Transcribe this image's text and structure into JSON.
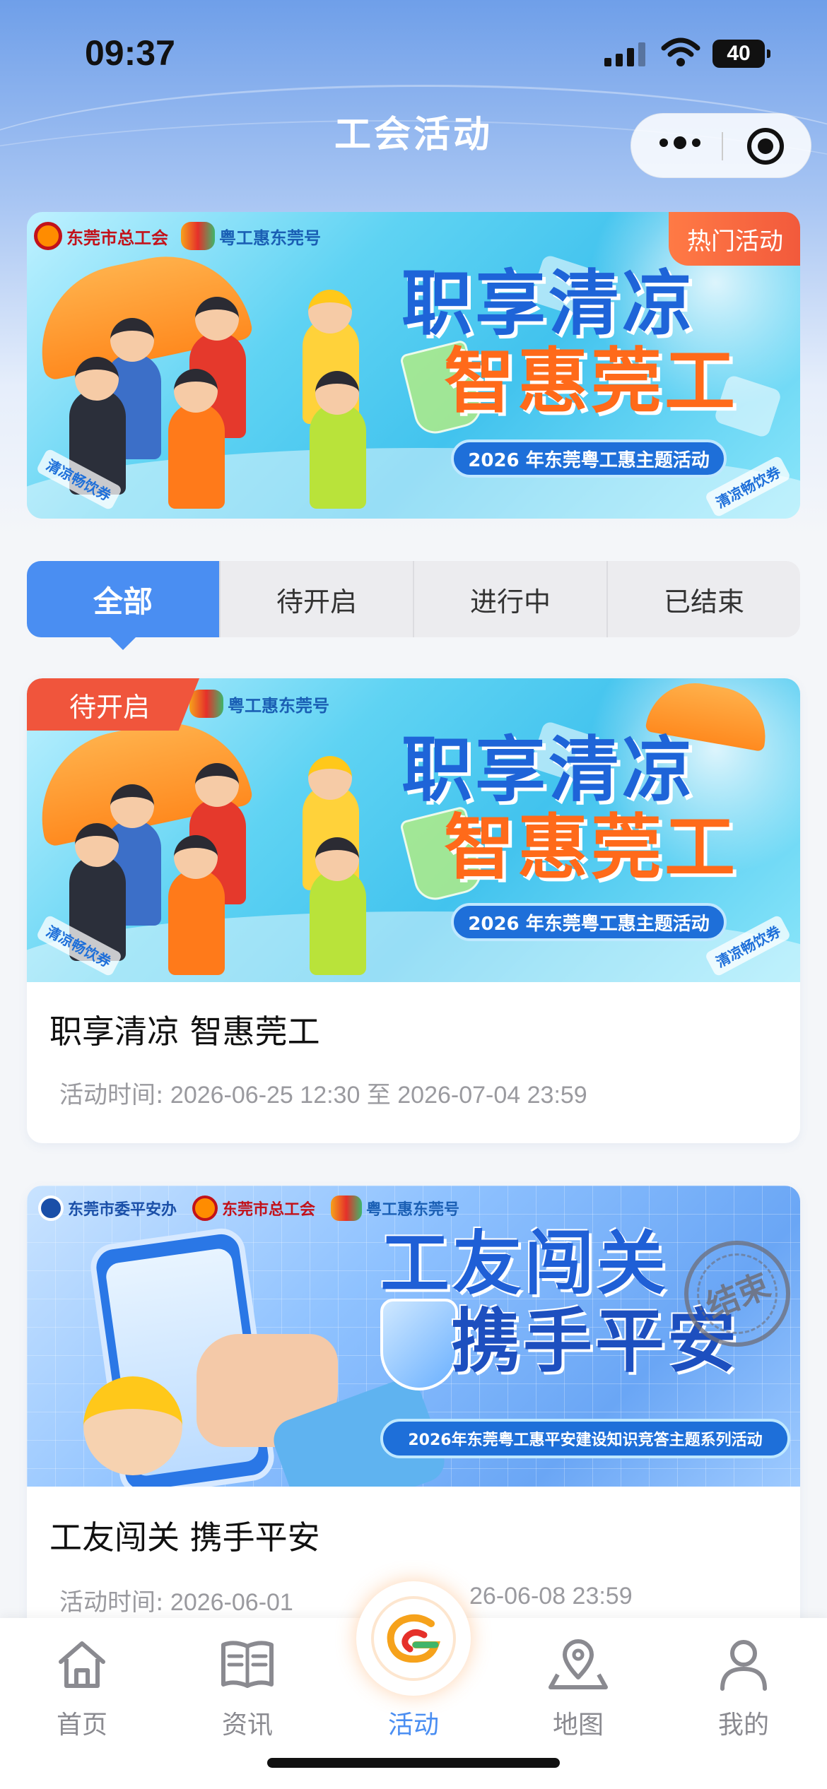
{
  "status_bar": {
    "time": "09:37",
    "battery": "40"
  },
  "nav": {
    "title": "工会活动"
  },
  "hero_banner": {
    "badge": "热门活动",
    "logo_left": "东莞市总工会",
    "logo_right": "粤工惠东莞号",
    "headline_line1": "职享清凉",
    "headline_line2": "智惠莞工",
    "subtitle": "2026 年东莞粤工惠主题活动",
    "stamp_left": "清凉畅饮券",
    "stamp_right": "清凉畅饮券"
  },
  "tabs": [
    {
      "label": "全部",
      "active": true
    },
    {
      "label": "待开启",
      "active": false
    },
    {
      "label": "进行中",
      "active": false
    },
    {
      "label": "已结束",
      "active": false
    }
  ],
  "activities": [
    {
      "status": "待开启",
      "banner_logo": "粤工惠东莞号",
      "banner_line1": "职享清凉",
      "banner_line2": "智惠莞工",
      "banner_subtitle": "2026 年东莞粤工惠主题活动",
      "banner_stamp_left": "清凉畅饮券",
      "banner_stamp_right": "清凉畅饮券",
      "title": "职享清凉 智惠莞工",
      "time_label": "活动时间:",
      "time_value": "2026-06-25 12:30 至 2026-07-04 23:59"
    },
    {
      "status": "结束",
      "banner_logo1": "东莞市委平安办",
      "banner_logo2": "东莞市总工会",
      "banner_logo3": "粤工惠东莞号",
      "banner_line1": "工友闯关",
      "banner_line2": "携手平安",
      "banner_subtitle": "2026年东莞粤工惠平安建设知识竞答主题系列活动",
      "title": "工友闯关 携手平安",
      "time_label": "活动时间:",
      "time_value_left": "2026-06-01",
      "time_value_right": "26-06-08 23:59"
    }
  ],
  "tabbar": [
    {
      "label": "首页",
      "icon": "home-icon",
      "active": false
    },
    {
      "label": "资讯",
      "icon": "book-icon",
      "active": false
    },
    {
      "label": "活动",
      "icon": "logo-g-icon",
      "active": true
    },
    {
      "label": "地图",
      "icon": "map-pin-icon",
      "active": false
    },
    {
      "label": "我的",
      "icon": "user-icon",
      "active": false
    }
  ],
  "colors": {
    "accent": "#4a8ef2",
    "badge_red": "#f0553c"
  }
}
